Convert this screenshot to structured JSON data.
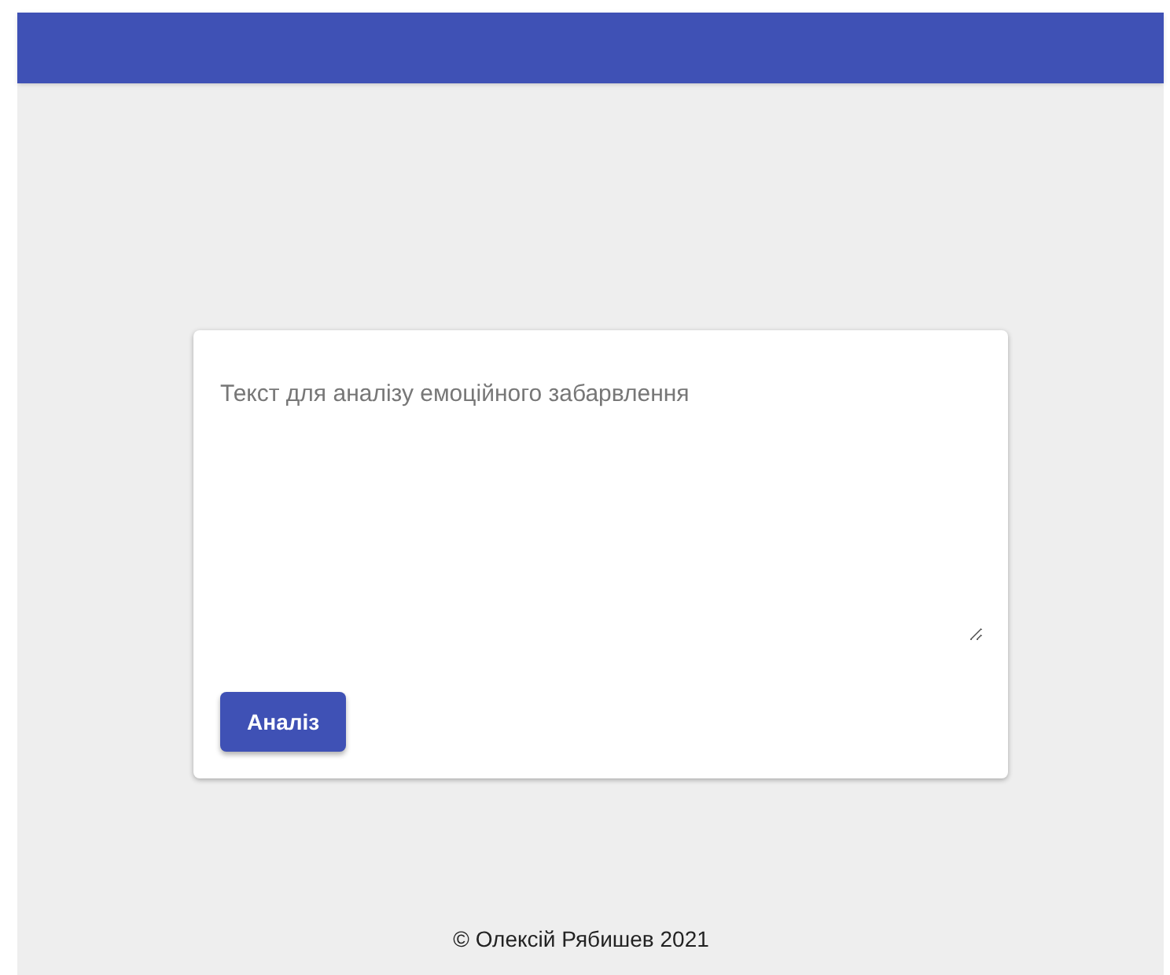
{
  "form": {
    "placeholder": "Текст для аналізу емоційного забарвлення",
    "button": "Аналіз"
  },
  "footer": "© Олексій Рябишев 2021"
}
